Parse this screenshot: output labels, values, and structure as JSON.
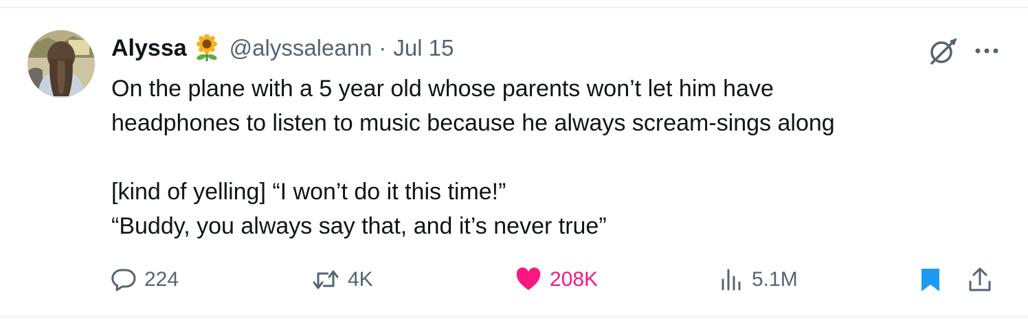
{
  "tweet": {
    "author_name": "Alyssa",
    "author_emoji": "sunflower-emoji",
    "handle": "@alyssaleann",
    "separator": "·",
    "date": "Jul 15",
    "lines": [
      "On the plane with a 5 year old whose parents won’t let him have",
      "headphones to listen to music because he always scream-sings along",
      "[kind of yelling] “I won’t do it this time!”",
      "“Buddy, you always say that, and it’s never true”"
    ]
  },
  "actions": {
    "replies": "224",
    "reposts": "4K",
    "likes": "208K",
    "views": "5.1M"
  },
  "icons": {
    "reply": "speech-bubble-icon",
    "repost": "repost-arrows-icon",
    "like": "heart-icon",
    "views": "bar-chart-icon",
    "bookmark": "bookmark-icon",
    "share": "share-upload-icon",
    "grok": "grok-icon",
    "more": "more-dots-icon"
  },
  "colors": {
    "text": "#0f1419",
    "secondary": "#536471",
    "like": "#f91880",
    "bookmark": "#1d9bf0",
    "divider": "#eff3f4"
  }
}
